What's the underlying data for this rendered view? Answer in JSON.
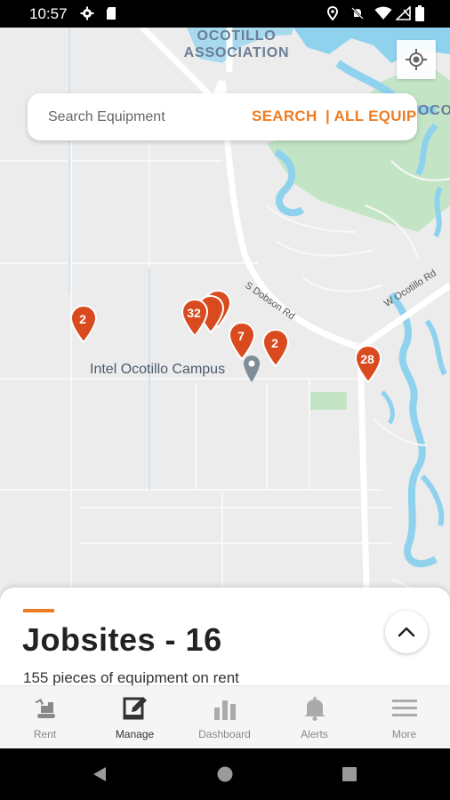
{
  "status_bar": {
    "time": "10:57",
    "left_icons": [
      "gear-icon",
      "sd-card-icon"
    ],
    "right_icons": [
      "location-pin-icon",
      "bell-off-icon",
      "wifi-icon",
      "no-sim-icon",
      "battery-icon"
    ]
  },
  "map": {
    "area_label": "OCOTILLO\nASSOCIATION",
    "area_label_line1": "OCOTILLO",
    "area_label_line2": "ASSOCIATION",
    "edge_label": "OCOT",
    "roads": [
      "S Dobson Rd",
      "W Ocotillo Rd"
    ],
    "poi": "Intel Ocotillo Campus",
    "pins": [
      {
        "count": "2"
      },
      {
        "count": "32"
      },
      {
        "count": "7"
      },
      {
        "count": "2"
      },
      {
        "count": "28"
      }
    ]
  },
  "search": {
    "placeholder": "Search Equipment",
    "search_label": "SEARCH",
    "all_label": "| ALL EQUIP"
  },
  "sheet": {
    "title": "Jobsites - 16",
    "subtitle": "155 pieces of equipment on rent"
  },
  "nav": {
    "items": [
      {
        "label": "Rent",
        "icon": "excavator-icon"
      },
      {
        "label": "Manage",
        "icon": "edit-icon",
        "active": true
      },
      {
        "label": "Dashboard",
        "icon": "bar-chart-icon"
      },
      {
        "label": "Alerts",
        "icon": "bell-icon"
      },
      {
        "label": "More",
        "icon": "menu-icon"
      }
    ]
  },
  "colors": {
    "accent": "#f07c21",
    "pin": "#d94a1e",
    "water": "#8fd2ee",
    "park": "#bfe3c3"
  }
}
